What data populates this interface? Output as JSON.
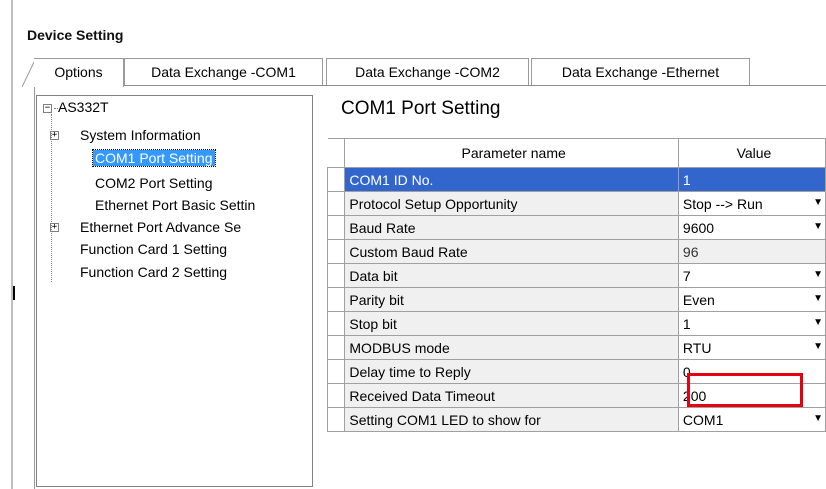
{
  "window": {
    "title": "Device Setting"
  },
  "tabs": [
    {
      "label": "Options",
      "active": true
    },
    {
      "label": "Data Exchange -COM1",
      "active": false
    },
    {
      "label": "Data Exchange -COM2",
      "active": false
    },
    {
      "label": "Data Exchange -Ethernet",
      "active": false
    }
  ],
  "tree": {
    "root": "AS332T",
    "items": [
      {
        "label": "System Information",
        "expandable": true
      },
      {
        "label": "COM1 Port Setting",
        "selected": true
      },
      {
        "label": "COM2 Port Setting"
      },
      {
        "label": "Ethernet Port Basic Settin"
      },
      {
        "label": "Ethernet Port Advance Se",
        "expandable": true
      },
      {
        "label": "Function Card 1 Setting"
      },
      {
        "label": "Function Card 2 Setting"
      }
    ]
  },
  "section": {
    "title": "COM1 Port Setting"
  },
  "grid": {
    "headers": {
      "name": "Parameter name",
      "value": "Value"
    },
    "rows": [
      {
        "name": "COM1 ID No.",
        "value": "1",
        "selected": true
      },
      {
        "name": "Protocol Setup Opportunity",
        "value": "Stop --> Run",
        "dropdown": true
      },
      {
        "name": "Baud Rate",
        "value": "9600",
        "dropdown": true
      },
      {
        "name": "Custom Baud Rate",
        "value": "96",
        "readonly": true
      },
      {
        "name": "Data bit",
        "value": "7",
        "dropdown": true
      },
      {
        "name": "Parity bit",
        "value": "Even",
        "dropdown": true
      },
      {
        "name": "Stop bit",
        "value": "1",
        "dropdown": true
      },
      {
        "name": "MODBUS mode",
        "value": "RTU",
        "dropdown": true,
        "highlighted": true
      },
      {
        "name": "Delay time to Reply",
        "value": "0"
      },
      {
        "name": "Received Data Timeout",
        "value": "200"
      },
      {
        "name": "Setting COM1 LED to show for",
        "value": "COM1",
        "dropdown": true
      }
    ]
  },
  "colors": {
    "selection": "#3366cc",
    "tree_selection": "#3399ff",
    "highlight_box": "#e60012"
  },
  "icons": {
    "expand": "plus-box-icon",
    "collapse": "minus-box-icon",
    "dropdown": "dropdown-arrow-icon"
  }
}
